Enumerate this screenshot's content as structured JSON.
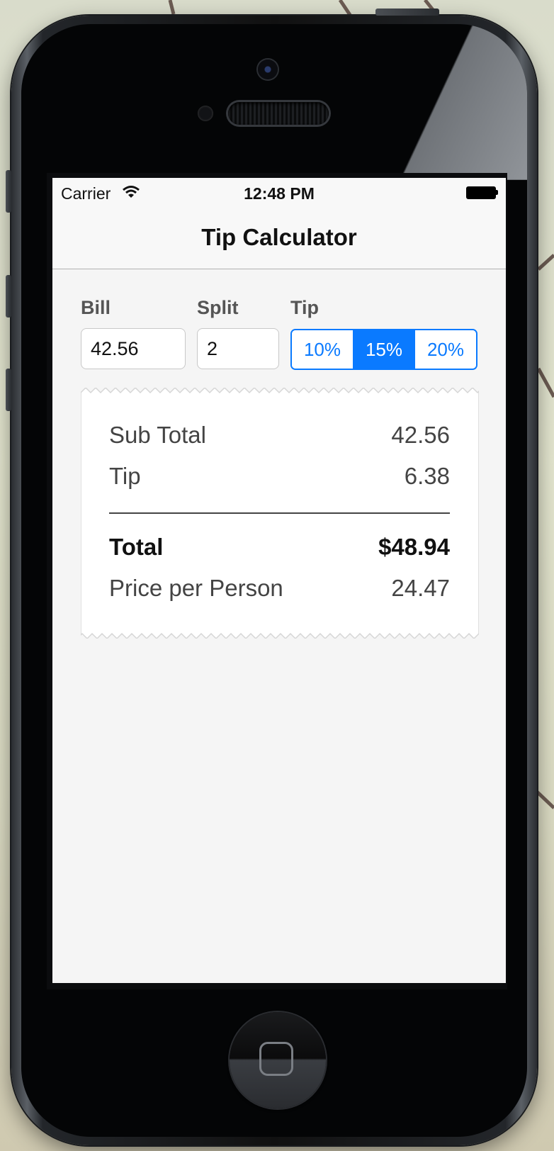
{
  "status_bar": {
    "carrier": "Carrier",
    "time": "12:48 PM",
    "wifi_icon": "wifi-icon",
    "battery_icon": "battery-icon",
    "battery_level": 1.0
  },
  "nav": {
    "title": "Tip Calculator"
  },
  "form": {
    "bill": {
      "label": "Bill",
      "value": "42.56"
    },
    "split": {
      "label": "Split",
      "value": "2"
    },
    "tip": {
      "label": "Tip",
      "options": [
        "10%",
        "15%",
        "20%"
      ],
      "selected": "15%"
    }
  },
  "receipt": {
    "sub_total": {
      "label": "Sub Total",
      "value": "42.56"
    },
    "tip": {
      "label": "Tip",
      "value": "6.38"
    },
    "total": {
      "label": "Total",
      "value": "$48.94"
    },
    "per_person": {
      "label": "Price per Person",
      "value": "24.47"
    }
  },
  "colors": {
    "accent": "#0a7aff",
    "screen_background": "#f5f5f5",
    "phone_body": "#040506"
  },
  "device": {
    "home_button_icon": "home-square-icon"
  }
}
